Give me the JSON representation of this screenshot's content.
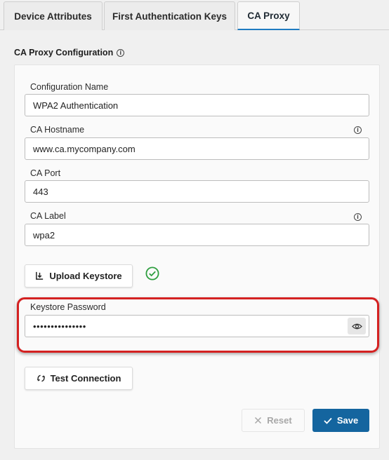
{
  "tabs": [
    {
      "label": "Device Attributes",
      "active": false
    },
    {
      "label": "First Authentication Keys",
      "active": false
    },
    {
      "label": "CA Proxy",
      "active": true
    }
  ],
  "section": {
    "title": "CA Proxy Configuration",
    "info_icon": "info-icon"
  },
  "form": {
    "config_name": {
      "label": "Configuration Name",
      "value": "WPA2 Authentication"
    },
    "ca_hostname": {
      "label": "CA Hostname",
      "value": "www.ca.mycompany.com",
      "info_icon": "info-icon"
    },
    "ca_port": {
      "label": "CA Port",
      "value": "443"
    },
    "ca_label": {
      "label": "CA Label",
      "value": "wpa2",
      "info_icon": "info-icon"
    },
    "keystore_password": {
      "label": "Keystore Password",
      "value": "•••••••••••••••",
      "reveal_icon": "eye-icon"
    }
  },
  "buttons": {
    "upload_keystore": {
      "label": "Upload Keystore",
      "icon": "upload-icon"
    },
    "upload_status_icon": "check-circle-icon",
    "test_connection": {
      "label": "Test Connection",
      "icon": "refresh-icon"
    },
    "reset": {
      "label": "Reset",
      "icon": "close-icon",
      "disabled": true
    },
    "save": {
      "label": "Save",
      "icon": "check-icon"
    }
  },
  "colors": {
    "accent": "#1f7cc1",
    "save_button": "#14659f",
    "highlight": "#d42121",
    "success": "#2e9e3f"
  }
}
